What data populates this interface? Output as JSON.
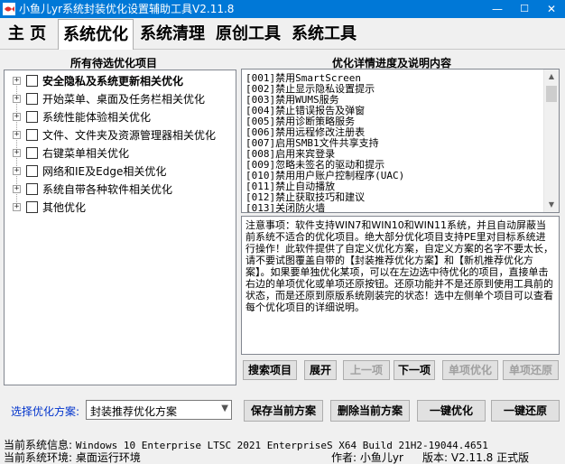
{
  "window": {
    "title": "小鱼儿yr系统封装优化设置辅助工具V2.11.8",
    "minimize": "—",
    "maximize": "☐",
    "close": "✕"
  },
  "tabs": [
    {
      "label": "主 页"
    },
    {
      "label": "系统优化",
      "active": true
    },
    {
      "label": "系统清理"
    },
    {
      "label": "原创工具"
    },
    {
      "label": "系统工具"
    }
  ],
  "left_panel": {
    "title": "所有待选优化项目",
    "items": [
      {
        "label": "安全隐私及系统更新相关优化",
        "bold": true
      },
      {
        "label": "开始菜单、桌面及任务栏相关优化"
      },
      {
        "label": "系统性能体验相关优化"
      },
      {
        "label": "文件、文件夹及资源管理器相关优化"
      },
      {
        "label": "右键菜单相关优化"
      },
      {
        "label": "网络和IE及Edge相关优化"
      },
      {
        "label": "系统自带各种软件相关优化"
      },
      {
        "label": "其他优化"
      }
    ]
  },
  "right_panel": {
    "title": "优化详情进度及说明内容",
    "list": [
      "[001]禁用SmartScreen",
      "[002]禁止显示隐私设置提示",
      "[003]禁用WUMS服务",
      "[004]禁止错误报告及弹窗",
      "[005]禁用诊断策略服务",
      "[006]禁用远程修改注册表",
      "[007]启用SMB1文件共享支持",
      "[008]启用来宾登录",
      "[009]忽略未签名的驱动和提示",
      "[010]禁用用户账户控制程序(UAC)",
      "[011]禁止自动播放",
      "[012]禁止获取技巧和建议",
      "[013]关闭防火墙"
    ],
    "notes": "注意事项：软件支持WIN7和WIN10和WIN11系统，并且自动屏蔽当前系统不适合的优化项目。绝大部分优化项目支持PE里对目标系统进行操作！此软件提供了自定义优化方案，自定义方案的名字不要太长，请不要试图覆盖自带的【封装推荐优化方案】和【新机推荐优化方案】。如果要单独优化某项，可以在左边选中待优化的项目，直接单击右边的单项优化或单项还原按钮。还原功能并不是还原到使用工具前的状态，而是还原到原版系统刚装完的状态！选中左侧单个项目可以查看每个优化项目的详细说明。"
  },
  "action_buttons": [
    {
      "label": "搜索项目",
      "enabled": true
    },
    {
      "label": "展开",
      "enabled": true
    },
    {
      "label": "上一项",
      "enabled": false
    },
    {
      "label": "下一项",
      "enabled": true
    },
    {
      "label": "单项优化",
      "enabled": false
    },
    {
      "label": "单项还原",
      "enabled": false
    }
  ],
  "scheme": {
    "label": "选择优化方案:",
    "selected": "封装推荐优化方案"
  },
  "bottom_buttons": [
    {
      "label": "保存当前方案"
    },
    {
      "label": "删除当前方案"
    },
    {
      "label": "一键优化"
    },
    {
      "label": "一键还原"
    }
  ],
  "status": {
    "sysinfo_label": "当前系统信息:",
    "sysinfo_value": "Windows 10 Enterprise LTSC 2021 EnterpriseS X64 Build 21H2-19044.4651",
    "env_label": "当前系统环境:",
    "env_value": "桌面运行环境",
    "author_label": "作者:",
    "author_value": "小鱼儿yr",
    "version_label": "版本:",
    "version_value": "V2.11.8 正式版"
  },
  "colors": {
    "titlebar": "#0078d7",
    "accent_label": "#0033cc"
  }
}
